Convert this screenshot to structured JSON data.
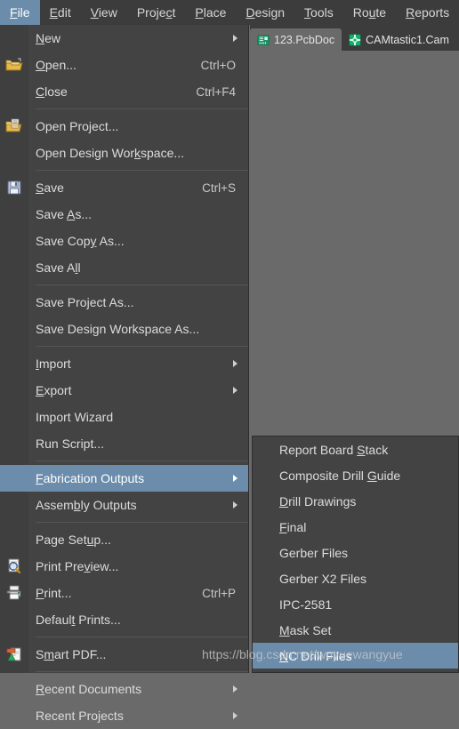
{
  "colors": {
    "menubar_bg": "#3c3c3c",
    "menu_bg": "#434343",
    "canvas_bg": "#6b6a6a",
    "highlight": "#6b8cab",
    "text": "#dcdcdc",
    "separator": "#565656",
    "tab_icon_green": "#16a06a"
  },
  "menubar": {
    "items": [
      {
        "label": "File",
        "mnemonic": "F",
        "active": true
      },
      {
        "label": "Edit",
        "mnemonic": "E",
        "active": false
      },
      {
        "label": "View",
        "mnemonic": "V",
        "active": false
      },
      {
        "label": "Project",
        "mnemonic": "c",
        "active": false
      },
      {
        "label": "Place",
        "mnemonic": "P",
        "active": false
      },
      {
        "label": "Design",
        "mnemonic": "D",
        "active": false
      },
      {
        "label": "Tools",
        "mnemonic": "T",
        "active": false
      },
      {
        "label": "Route",
        "mnemonic": "u",
        "active": false
      },
      {
        "label": "Reports",
        "mnemonic": "R",
        "active": false
      }
    ]
  },
  "tabs": [
    {
      "label": "123.PcbDoc",
      "icon": "pcb-document-icon",
      "active": true
    },
    {
      "label": "CAMtastic1.Cam",
      "icon": "camtastic-document-icon",
      "active": false
    }
  ],
  "file_menu": {
    "items": [
      {
        "label": "New",
        "mnemonic": "N",
        "accel": "",
        "icon": "",
        "submenu": true,
        "selected": false
      },
      {
        "label": "Open...",
        "mnemonic": "O",
        "accel": "Ctrl+O",
        "icon": "open-folder-icon",
        "submenu": false,
        "selected": false
      },
      {
        "label": "Close",
        "mnemonic": "C",
        "accel": "Ctrl+F4",
        "icon": "",
        "submenu": false,
        "selected": false
      },
      {
        "separator": true
      },
      {
        "label": "Open Project...",
        "mnemonic": "",
        "accel": "",
        "icon": "open-project-icon",
        "submenu": false,
        "selected": false
      },
      {
        "label": "Open Design Workspace...",
        "mnemonic": "k",
        "accel": "",
        "icon": "",
        "submenu": false,
        "selected": false
      },
      {
        "separator": true
      },
      {
        "label": "Save",
        "mnemonic": "S",
        "accel": "Ctrl+S",
        "icon": "save-disk-icon",
        "submenu": false,
        "selected": false
      },
      {
        "label": "Save As...",
        "mnemonic": "A",
        "accel": "",
        "icon": "",
        "submenu": false,
        "selected": false
      },
      {
        "label": "Save Copy As...",
        "mnemonic": "y",
        "accel": "",
        "icon": "",
        "submenu": false,
        "selected": false
      },
      {
        "label": "Save All",
        "mnemonic": "l",
        "accel": "",
        "icon": "",
        "submenu": false,
        "selected": false
      },
      {
        "separator": true
      },
      {
        "label": "Save Project As...",
        "mnemonic": "",
        "accel": "",
        "icon": "",
        "submenu": false,
        "selected": false
      },
      {
        "label": "Save Design Workspace As...",
        "mnemonic": "",
        "accel": "",
        "icon": "",
        "submenu": false,
        "selected": false
      },
      {
        "separator": true
      },
      {
        "label": "Import",
        "mnemonic": "I",
        "accel": "",
        "icon": "",
        "submenu": true,
        "selected": false
      },
      {
        "label": "Export",
        "mnemonic": "E",
        "accel": "",
        "icon": "",
        "submenu": true,
        "selected": false
      },
      {
        "label": "Import Wizard",
        "mnemonic": "",
        "accel": "",
        "icon": "",
        "submenu": false,
        "selected": false
      },
      {
        "label": "Run Script...",
        "mnemonic": "",
        "accel": "",
        "icon": "",
        "submenu": false,
        "selected": false
      },
      {
        "separator": true
      },
      {
        "label": "Fabrication Outputs",
        "mnemonic": "F",
        "accel": "",
        "icon": "",
        "submenu": true,
        "selected": true
      },
      {
        "label": "Assembly Outputs",
        "mnemonic": "b",
        "accel": "",
        "icon": "",
        "submenu": true,
        "selected": false
      },
      {
        "separator": true
      },
      {
        "label": "Page Setup...",
        "mnemonic": "u",
        "accel": "",
        "icon": "",
        "submenu": false,
        "selected": false
      },
      {
        "label": "Print Preview...",
        "mnemonic": "v",
        "accel": "",
        "icon": "print-preview-icon",
        "submenu": false,
        "selected": false
      },
      {
        "label": "Print...",
        "mnemonic": "P",
        "accel": "Ctrl+P",
        "icon": "printer-icon",
        "submenu": false,
        "selected": false
      },
      {
        "label": "Default Prints...",
        "mnemonic": "t",
        "accel": "",
        "icon": "",
        "submenu": false,
        "selected": false
      },
      {
        "separator": true
      },
      {
        "label": "Smart PDF...",
        "mnemonic": "m",
        "accel": "",
        "icon": "smart-pdf-icon",
        "submenu": false,
        "selected": false
      },
      {
        "separator": true
      },
      {
        "label": "Recent Documents",
        "mnemonic": "R",
        "accel": "",
        "icon": "",
        "submenu": true,
        "selected": false
      },
      {
        "label": "Recent Projects",
        "mnemonic": "",
        "accel": "",
        "icon": "",
        "submenu": true,
        "selected": false
      }
    ]
  },
  "fabrication_submenu": {
    "items": [
      {
        "label": "Report Board Stack",
        "mnemonic": "S",
        "selected": false
      },
      {
        "label": "Composite Drill Guide",
        "mnemonic": "G",
        "selected": false
      },
      {
        "label": "Drill Drawings",
        "mnemonic": "D",
        "selected": false
      },
      {
        "label": "Final",
        "mnemonic": "F",
        "selected": false
      },
      {
        "label": "Gerber Files",
        "mnemonic": "",
        "selected": false
      },
      {
        "label": "Gerber X2 Files",
        "mnemonic": "",
        "selected": false
      },
      {
        "label": "IPC-2581",
        "mnemonic": "",
        "selected": false
      },
      {
        "label": "Mask Set",
        "mnemonic": "M",
        "selected": false
      },
      {
        "label": "NC Drill Files",
        "mnemonic": "N",
        "selected": true
      }
    ]
  },
  "watermark": {
    "text": "https://blog.csdn.net/wuyuewangyue"
  }
}
